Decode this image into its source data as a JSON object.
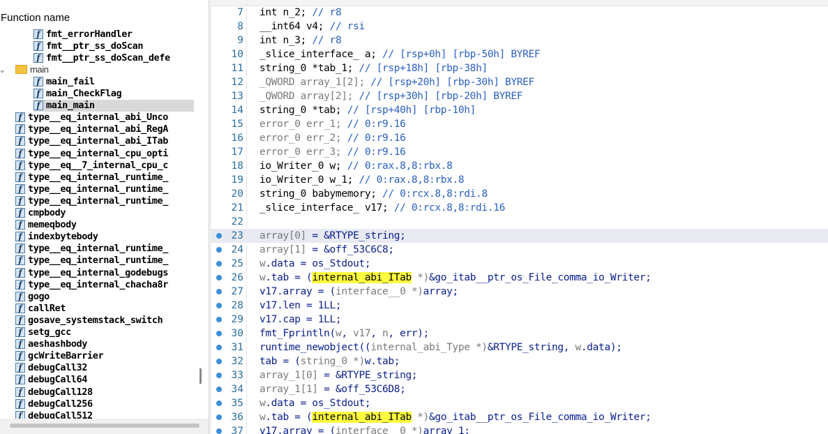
{
  "function_pane": {
    "header": "Function name",
    "items": [
      {
        "name": "fmt_errorHandler",
        "indent": 1,
        "kind": "func"
      },
      {
        "name": "fmt__ptr_ss_doScan",
        "indent": 1,
        "kind": "func"
      },
      {
        "name": "fmt__ptr_ss_doScan_defe",
        "indent": 1,
        "kind": "func"
      },
      {
        "name": "main",
        "indent": 0,
        "kind": "folder"
      },
      {
        "name": "main_fail",
        "indent": 1,
        "kind": "func"
      },
      {
        "name": "main_CheckFlag",
        "indent": 1,
        "kind": "func"
      },
      {
        "name": "main_main",
        "indent": 1,
        "kind": "func",
        "selected": true
      },
      {
        "name": "type__eq_internal_abi_Unco",
        "indent": 0,
        "kind": "func"
      },
      {
        "name": "type__eq_internal_abi_RegA",
        "indent": 0,
        "kind": "func"
      },
      {
        "name": "type__eq_internal_abi_ITab",
        "indent": 0,
        "kind": "func"
      },
      {
        "name": "type__eq_internal_cpu_opti",
        "indent": 0,
        "kind": "func"
      },
      {
        "name": "type__eq__7_internal_cpu_c",
        "indent": 0,
        "kind": "func"
      },
      {
        "name": "type__eq_internal_runtime_",
        "indent": 0,
        "kind": "func"
      },
      {
        "name": "type__eq_internal_runtime_",
        "indent": 0,
        "kind": "func"
      },
      {
        "name": "type__eq_internal_runtime_",
        "indent": 0,
        "kind": "func"
      },
      {
        "name": "cmpbody",
        "indent": 0,
        "kind": "func"
      },
      {
        "name": "memeqbody",
        "indent": 0,
        "kind": "func"
      },
      {
        "name": "indexbytebody",
        "indent": 0,
        "kind": "func"
      },
      {
        "name": "type__eq_internal_runtime_",
        "indent": 0,
        "kind": "func"
      },
      {
        "name": "type__eq_internal_runtime_",
        "indent": 0,
        "kind": "func"
      },
      {
        "name": "type__eq_internal_godebugs",
        "indent": 0,
        "kind": "func"
      },
      {
        "name": "type__eq_internal_chacha8r",
        "indent": 0,
        "kind": "func"
      },
      {
        "name": "gogo",
        "indent": 0,
        "kind": "func"
      },
      {
        "name": "callRet",
        "indent": 0,
        "kind": "func"
      },
      {
        "name": "gosave_systemstack_switch",
        "indent": 0,
        "kind": "func"
      },
      {
        "name": "setg_gcc",
        "indent": 0,
        "kind": "func"
      },
      {
        "name": "aeshashbody",
        "indent": 0,
        "kind": "func"
      },
      {
        "name": "gcWriteBarrier",
        "indent": 0,
        "kind": "func"
      },
      {
        "name": "debugCall32",
        "indent": 0,
        "kind": "func"
      },
      {
        "name": "debugCall64",
        "indent": 0,
        "kind": "func"
      },
      {
        "name": "debugCall128",
        "indent": 0,
        "kind": "func"
      },
      {
        "name": "debugCall256",
        "indent": 0,
        "kind": "func"
      },
      {
        "name": "debugCall512",
        "indent": 0,
        "kind": "func"
      }
    ],
    "func_icon_glyph": "f",
    "expand_glyph": "⌄"
  },
  "code": {
    "lines": [
      {
        "n": "7",
        "dot": false,
        "tokens": [
          [
            "type",
            "int n_2; "
          ],
          [
            "cmt",
            "// r8"
          ]
        ]
      },
      {
        "n": "8",
        "dot": false,
        "tokens": [
          [
            "type",
            "__int64 v4; "
          ],
          [
            "cmt",
            "// rsi"
          ]
        ]
      },
      {
        "n": "9",
        "dot": false,
        "tokens": [
          [
            "type",
            "int n_3; "
          ],
          [
            "cmt",
            "// r8"
          ]
        ]
      },
      {
        "n": "10",
        "dot": false,
        "tokens": [
          [
            "type",
            "_slice_interface_ a; "
          ],
          [
            "cmt",
            "// [rsp+0h] [rbp-50h] BYREF"
          ]
        ]
      },
      {
        "n": "11",
        "dot": false,
        "tokens": [
          [
            "type",
            "string_0 *tab_1; "
          ],
          [
            "cmt",
            "// [rsp+18h] [rbp-38h]"
          ]
        ]
      },
      {
        "n": "12",
        "dot": false,
        "tokens": [
          [
            "gray",
            "_QWORD array_1[2]; "
          ],
          [
            "cmt",
            "// [rsp+20h] [rbp-30h] BYREF"
          ]
        ]
      },
      {
        "n": "13",
        "dot": false,
        "tokens": [
          [
            "gray",
            "_QWORD array[2]; "
          ],
          [
            "cmt",
            "// [rsp+30h] [rbp-20h] BYREF"
          ]
        ]
      },
      {
        "n": "14",
        "dot": false,
        "tokens": [
          [
            "type",
            "string_0 *tab; "
          ],
          [
            "cmt",
            "// [rsp+40h] [rbp-10h]"
          ]
        ]
      },
      {
        "n": "15",
        "dot": false,
        "tokens": [
          [
            "gray",
            "error_0 err_1; "
          ],
          [
            "cmt",
            "// 0:r9.16"
          ]
        ]
      },
      {
        "n": "16",
        "dot": false,
        "tokens": [
          [
            "gray",
            "error_0 err_2; "
          ],
          [
            "cmt",
            "// 0:r9.16"
          ]
        ]
      },
      {
        "n": "17",
        "dot": false,
        "tokens": [
          [
            "gray",
            "error_0 err_3; "
          ],
          [
            "cmt",
            "// 0:r9.16"
          ]
        ]
      },
      {
        "n": "18",
        "dot": false,
        "tokens": [
          [
            "type",
            "io_Writer_0 w; "
          ],
          [
            "cmt",
            "// 0:rax.8,8:rbx.8"
          ]
        ]
      },
      {
        "n": "19",
        "dot": false,
        "tokens": [
          [
            "type",
            "io_Writer_0 w_1; "
          ],
          [
            "cmt",
            "// 0:rax.8,8:rbx.8"
          ]
        ]
      },
      {
        "n": "20",
        "dot": false,
        "tokens": [
          [
            "type",
            "string_0 babymemory; "
          ],
          [
            "cmt",
            "// 0:rcx.8,8:rdi.8"
          ]
        ]
      },
      {
        "n": "21",
        "dot": false,
        "tokens": [
          [
            "type",
            "_slice_interface_ v17; "
          ],
          [
            "cmt",
            "// 0:rcx.8,8:rdi.16"
          ]
        ]
      },
      {
        "n": "22",
        "dot": false,
        "tokens": []
      },
      {
        "n": "23",
        "dot": true,
        "cursor": true,
        "tokens": [
          [
            "gray",
            "array[0] "
          ],
          [
            "var",
            "= &RTYPE_string;"
          ]
        ]
      },
      {
        "n": "24",
        "dot": true,
        "tokens": [
          [
            "gray",
            "array[1] "
          ],
          [
            "var",
            "= &off_53C6C8;"
          ]
        ]
      },
      {
        "n": "25",
        "dot": true,
        "tokens": [
          [
            "gray",
            "w"
          ],
          [
            "var",
            ".data = os_Stdout;"
          ]
        ]
      },
      {
        "n": "26",
        "dot": true,
        "tokens": [
          [
            "gray",
            "w"
          ],
          [
            "var",
            ".tab = ("
          ],
          [
            "hl",
            "internal_abi_ITab"
          ],
          [
            "gray",
            " *)"
          ],
          [
            "var",
            "&go_itab__ptr_os_File_comma_io_Writer;"
          ]
        ]
      },
      {
        "n": "27",
        "dot": true,
        "tokens": [
          [
            "var",
            "v17.array = ("
          ],
          [
            "gray",
            "interface__0 *)"
          ],
          [
            "var",
            "array;"
          ]
        ]
      },
      {
        "n": "28",
        "dot": true,
        "tokens": [
          [
            "var",
            "v17.len = 1LL;"
          ]
        ]
      },
      {
        "n": "29",
        "dot": true,
        "tokens": [
          [
            "var",
            "v17.cap = 1LL;"
          ]
        ]
      },
      {
        "n": "30",
        "dot": true,
        "tokens": [
          [
            "var",
            "fmt_Fprintln("
          ],
          [
            "gray",
            "w"
          ],
          [
            "var",
            ", "
          ],
          [
            "gray",
            "v17"
          ],
          [
            "var",
            ", "
          ],
          [
            "gray",
            "n"
          ],
          [
            "var",
            ", err);"
          ]
        ]
      },
      {
        "n": "31",
        "dot": true,
        "tokens": [
          [
            "var",
            "runtime_newobject(("
          ],
          [
            "gray",
            "internal_abi_Type *)"
          ],
          [
            "var",
            "&RTYPE_string, "
          ],
          [
            "gray",
            "w"
          ],
          [
            "var",
            ".data);"
          ]
        ]
      },
      {
        "n": "32",
        "dot": true,
        "tokens": [
          [
            "var",
            "tab = ("
          ],
          [
            "gray",
            "string_0 *)"
          ],
          [
            "var",
            "w.tab;"
          ]
        ]
      },
      {
        "n": "33",
        "dot": true,
        "tokens": [
          [
            "gray",
            "array_1[0] "
          ],
          [
            "var",
            "= &RTYPE_string;"
          ]
        ]
      },
      {
        "n": "34",
        "dot": true,
        "tokens": [
          [
            "gray",
            "array_1[1] "
          ],
          [
            "var",
            "= &off_53C6D8;"
          ]
        ]
      },
      {
        "n": "35",
        "dot": true,
        "tokens": [
          [
            "gray",
            "w"
          ],
          [
            "var",
            ".data = os_Stdout;"
          ]
        ]
      },
      {
        "n": "36",
        "dot": true,
        "tokens": [
          [
            "gray",
            "w"
          ],
          [
            "var",
            ".tab = ("
          ],
          [
            "hl",
            "internal_abi_ITab"
          ],
          [
            "gray",
            " *)"
          ],
          [
            "var",
            "&go_itab__ptr_os_File_comma_io_Writer;"
          ]
        ]
      },
      {
        "n": "37",
        "dot": true,
        "tokens": [
          [
            "var",
            "v17.array = ("
          ],
          [
            "gray",
            "interface__0 *)"
          ],
          [
            "var",
            "array_1;"
          ]
        ]
      }
    ]
  }
}
